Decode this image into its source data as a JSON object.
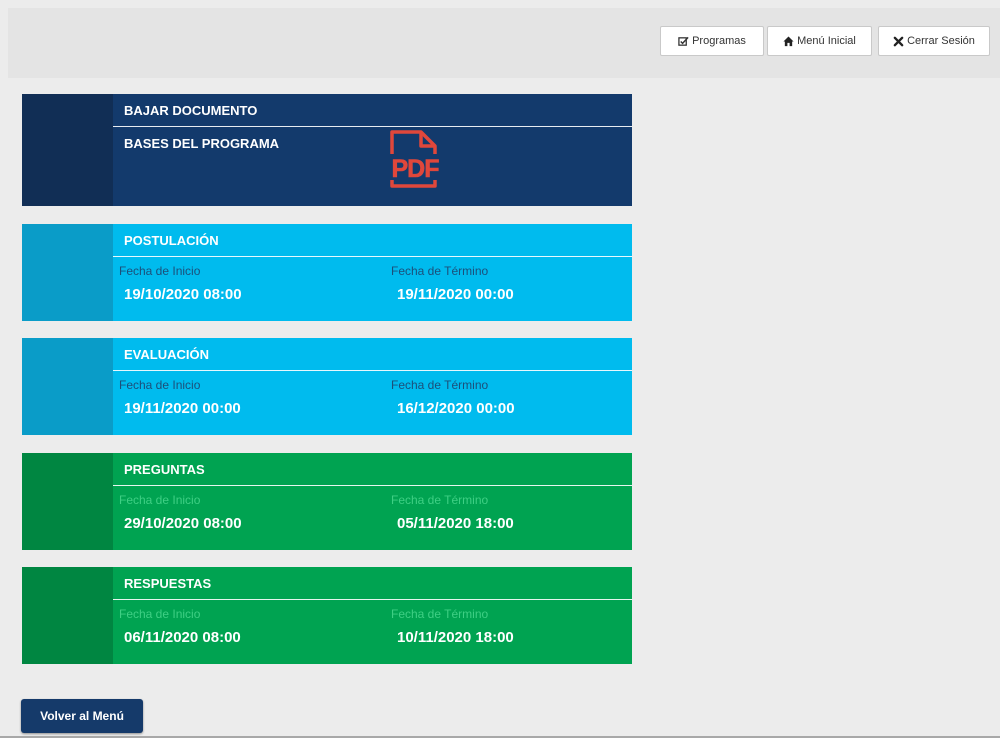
{
  "header": {
    "programs_label": "Programas",
    "menu_label": "Menú Inicial",
    "logout_label": "Cerrar Sesión"
  },
  "document": {
    "title": "BAJAR DOCUMENTO",
    "item": "BASES DEL PROGRAMA",
    "icon_text": "PDF"
  },
  "phases": [
    {
      "title": "POSTULACIÓN",
      "start_label": "Fecha de Inicio",
      "start_value": "19/10/2020 08:00",
      "end_label": "Fecha de Término",
      "end_value": "19/11/2020 00:00",
      "color": "#00bbee",
      "side_color": "#0a9cc8",
      "label_color": "#1c4f7a"
    },
    {
      "title": "EVALUACIÓN",
      "start_label": "Fecha de Inicio",
      "start_value": "19/11/2020 00:00",
      "end_label": "Fecha de Término",
      "end_value": "16/12/2020 00:00",
      "color": "#00bbee",
      "side_color": "#0a9cc8",
      "label_color": "#1c4f7a"
    },
    {
      "title": "PREGUNTAS",
      "start_label": "Fecha de Inicio",
      "start_value": "29/10/2020 08:00",
      "end_label": "Fecha de Término",
      "end_value": "05/11/2020 18:00",
      "color": "#00a351",
      "side_color": "#008641",
      "label_color": "#3ecf84"
    },
    {
      "title": "RESPUESTAS",
      "start_label": "Fecha de Inicio",
      "start_value": "06/11/2020 08:00",
      "end_label": "Fecha de Término",
      "end_value": "10/11/2020 18:00",
      "color": "#00a351",
      "side_color": "#008641",
      "label_color": "#3ecf84"
    }
  ],
  "footer": {
    "back_label": "Volver al Menú"
  },
  "colors": {
    "document_bg": "#133a6c",
    "document_side": "#112e55",
    "pdf_red": "#e0473b"
  }
}
